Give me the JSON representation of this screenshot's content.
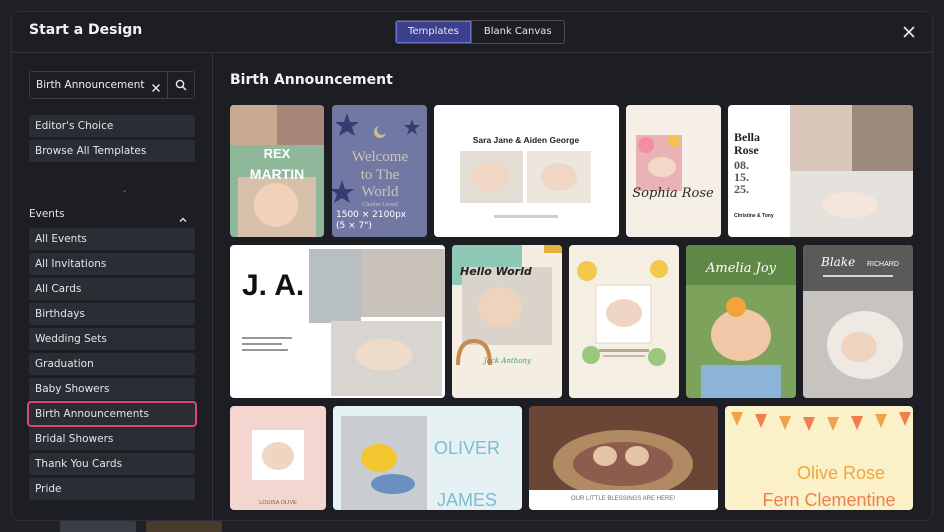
{
  "modal": {
    "title": "Start a Design",
    "tabs": [
      {
        "label": "Templates",
        "active": true
      },
      {
        "label": "Blank Canvas",
        "active": false
      }
    ]
  },
  "search": {
    "value": "Birth Announcement"
  },
  "sidebar": {
    "top_items": [
      "Editor's Choice",
      "Browse All Templates"
    ],
    "section": "Events",
    "items": [
      "All Events",
      "All Invitations",
      "All Cards",
      "Birthdays",
      "Wedding Sets",
      "Graduation",
      "Baby Showers",
      "Birth Announcements",
      "Bridal Showers",
      "Thank You Cards",
      "Pride"
    ],
    "selected": "Birth Announcements"
  },
  "content": {
    "title": "Birth Announcement",
    "hover_card": {
      "size": "1500 × 2100px",
      "inches": "(5 × 7\")"
    },
    "cards": {
      "rex": [
        "REX",
        "MARTIN"
      ],
      "world": [
        "Welcome",
        "to The",
        "World"
      ],
      "world_small": "Charles Lionel",
      "sara": "Sara Jane & Aiden George",
      "sophia": "Sophia Rose",
      "bella": [
        "Bella",
        "Rose",
        "08.",
        "15.",
        "25."
      ],
      "bella_parents": "Christine & Tony",
      "ja": "J. A.",
      "hello": "Hello World",
      "jack": "Jack Anthony",
      "amelia": "Amelia Joy",
      "blake": [
        "Blake",
        "RICHARD"
      ],
      "louisa": "LOUISA OLIVE",
      "oliver": [
        "OLIVER",
        "JAMES"
      ],
      "blessings": "OUR LITTLE BLESSINGS ARE HERE!",
      "olive": [
        "Olive Rose",
        "Fern Clementine"
      ]
    }
  },
  "colors": {
    "accent": "#3d3f8f",
    "selected_outline": "#e0457a",
    "panel": "#1c1e23"
  }
}
